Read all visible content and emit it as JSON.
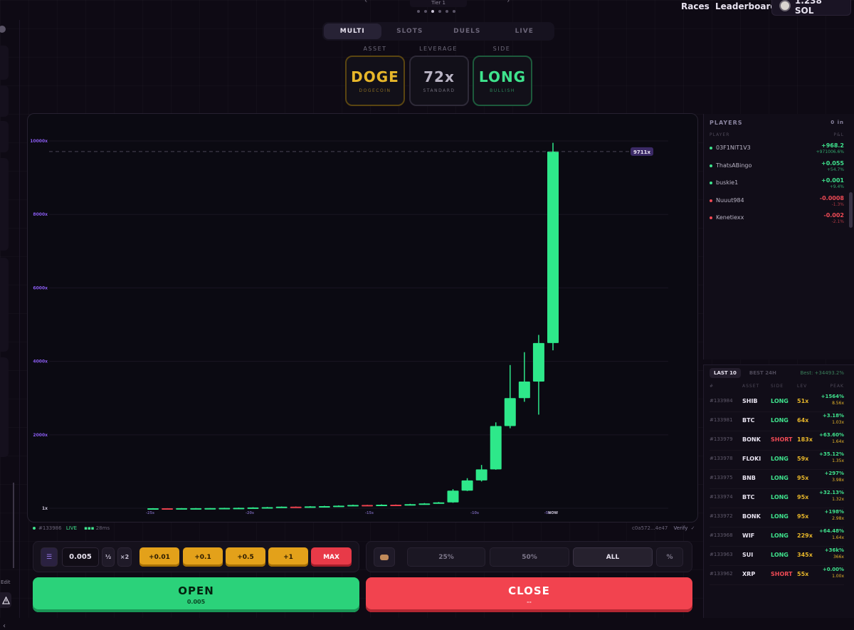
{
  "topbar": {
    "tier": "Tier 1",
    "nav": [
      "Races",
      "Leaderboard"
    ],
    "balance": "1.238 SOL"
  },
  "modes": {
    "tabs": [
      "MULTI",
      "SLOTS",
      "DUELS",
      "LIVE"
    ],
    "active": "MULTI"
  },
  "selectors": {
    "asset_label": "ASSET",
    "asset": "DOGE",
    "asset_sub": "DOGECOIN",
    "leverage_label": "LEVERAGE",
    "leverage": "72x",
    "leverage_sub": "STANDARD",
    "side_label": "SIDE",
    "side": "LONG",
    "side_sub": "BULLISH"
  },
  "chart_data": {
    "type": "candlestick",
    "y_ticks": [
      "1x",
      "2000x",
      "4000x",
      "6000x",
      "8000x",
      "10000x"
    ],
    "ylim": [
      1,
      10000
    ],
    "x_ticks": [
      "-25s",
      "-20s",
      "-15s",
      "-10s",
      "-5s",
      "NOW"
    ],
    "current_label": "9711x",
    "current_value": 9711,
    "colors": {
      "up": "#2ee88a",
      "down": "#e8414d"
    },
    "candles": [
      {
        "o": 1,
        "c": 2,
        "h": 4,
        "l": 0
      },
      {
        "o": 2,
        "c": 1,
        "h": 3,
        "l": 0
      },
      {
        "o": 1,
        "c": 3,
        "h": 5,
        "l": 0
      },
      {
        "o": 3,
        "c": 4,
        "h": 6,
        "l": 1
      },
      {
        "o": 4,
        "c": 6,
        "h": 8,
        "l": 3
      },
      {
        "o": 6,
        "c": 10,
        "h": 14,
        "l": 5
      },
      {
        "o": 10,
        "c": 14,
        "h": 18,
        "l": 8
      },
      {
        "o": 14,
        "c": 22,
        "h": 28,
        "l": 12
      },
      {
        "o": 22,
        "c": 30,
        "h": 38,
        "l": 20
      },
      {
        "o": 30,
        "c": 44,
        "h": 50,
        "l": 28
      },
      {
        "o": 44,
        "c": 38,
        "h": 50,
        "l": 30
      },
      {
        "o": 38,
        "c": 52,
        "h": 60,
        "l": 34
      },
      {
        "o": 52,
        "c": 60,
        "h": 68,
        "l": 48
      },
      {
        "o": 60,
        "c": 72,
        "h": 80,
        "l": 56
      },
      {
        "o": 72,
        "c": 90,
        "h": 100,
        "l": 68
      },
      {
        "o": 90,
        "c": 80,
        "h": 96,
        "l": 74
      },
      {
        "o": 80,
        "c": 98,
        "h": 108,
        "l": 76
      },
      {
        "o": 98,
        "c": 92,
        "h": 104,
        "l": 86
      },
      {
        "o": 92,
        "c": 112,
        "h": 122,
        "l": 88
      },
      {
        "o": 112,
        "c": 132,
        "h": 142,
        "l": 106
      },
      {
        "o": 132,
        "c": 160,
        "h": 172,
        "l": 128
      },
      {
        "o": 160,
        "c": 480,
        "h": 520,
        "l": 150
      },
      {
        "o": 480,
        "c": 760,
        "h": 820,
        "l": 470
      },
      {
        "o": 760,
        "c": 1060,
        "h": 1180,
        "l": 730
      },
      {
        "o": 1060,
        "c": 2240,
        "h": 2340,
        "l": 1050
      },
      {
        "o": 2240,
        "c": 3000,
        "h": 3900,
        "l": 2180
      },
      {
        "o": 3000,
        "c": 3450,
        "h": 4250,
        "l": 2900
      },
      {
        "o": 3450,
        "c": 4500,
        "h": 4720,
        "l": 2550
      },
      {
        "o": 4500,
        "c": 9711,
        "h": 9950,
        "l": 4300
      }
    ]
  },
  "chart_footer": {
    "round": "#133986",
    "status": "LIVE",
    "ping": "28ms",
    "hash": "c0a572...4e47",
    "verify": "Verify"
  },
  "players": {
    "title": "PLAYERS",
    "count": "0 in",
    "col_player": "PLAYER",
    "col_pnl": "P&L",
    "rows": [
      {
        "name": "03F1NIT1V3",
        "pnl": "+968.2",
        "pct": "+971006.6%",
        "color": "#3fe38d"
      },
      {
        "name": "ThatsABingo",
        "pnl": "+0.055",
        "pct": "+54.7%",
        "color": "#3fe38d"
      },
      {
        "name": "buskie1",
        "pnl": "+0.001",
        "pct": "+9.4%",
        "color": "#3fe38d"
      },
      {
        "name": "Nuuut984",
        "pnl": "-0.0008",
        "pct": "-1.3%",
        "color": "#ef4a55"
      },
      {
        "name": "Kenetiexx",
        "pnl": "-0.002",
        "pct": "-2.1%",
        "color": "#ef4a55"
      }
    ]
  },
  "last10": {
    "tab_last": "LAST 10",
    "tab_best": "BEST 24H",
    "best": "Best: +34493.2%",
    "cols": [
      "#",
      "ASSET",
      "SIDE",
      "LEV",
      "PEAK"
    ],
    "rows": [
      {
        "id": "#133984",
        "asset": "SHIB",
        "side": "LONG",
        "lev": "51x",
        "peak": "+1564%",
        "mult": "8.56x"
      },
      {
        "id": "#133981",
        "asset": "BTC",
        "side": "LONG",
        "lev": "64x",
        "peak": "+3.18%",
        "mult": "1.03x"
      },
      {
        "id": "#133979",
        "asset": "BONK",
        "side": "SHORT",
        "lev": "183x",
        "peak": "+63.60%",
        "mult": "1.64x"
      },
      {
        "id": "#133978",
        "asset": "FLOKI",
        "side": "LONG",
        "lev": "59x",
        "peak": "+35.12%",
        "mult": "1.35x"
      },
      {
        "id": "#133975",
        "asset": "BNB",
        "side": "LONG",
        "lev": "95x",
        "peak": "+297%",
        "mult": "3.98x"
      },
      {
        "id": "#133974",
        "asset": "BTC",
        "side": "LONG",
        "lev": "95x",
        "peak": "+32.13%",
        "mult": "1.32x"
      },
      {
        "id": "#133972",
        "asset": "BONK",
        "side": "LONG",
        "lev": "95x",
        "peak": "+198%",
        "mult": "2.98x"
      },
      {
        "id": "#133968",
        "asset": "WIF",
        "side": "LONG",
        "lev": "229x",
        "peak": "+64.48%",
        "mult": "1.64x"
      },
      {
        "id": "#133963",
        "asset": "SUI",
        "side": "LONG",
        "lev": "345x",
        "peak": "+36k%",
        "mult": "366x"
      },
      {
        "id": "#133962",
        "asset": "XRP",
        "side": "SHORT",
        "lev": "55x",
        "peak": "+0.00%",
        "mult": "1.00x"
      }
    ]
  },
  "bet": {
    "amount": "0.005",
    "half": "½",
    "double": "×2",
    "adds": [
      "+0.01",
      "+0.1",
      "+0.5",
      "+1"
    ],
    "max": "MAX"
  },
  "close_pcts": {
    "options": [
      "25%",
      "50%",
      "ALL"
    ],
    "active": "ALL",
    "pct_btn": "%"
  },
  "actions": {
    "open": "OPEN",
    "open_amount": "0.005",
    "close": "CLOSE",
    "close_amount": "--"
  },
  "sidebar": {
    "edit": "Edit"
  }
}
